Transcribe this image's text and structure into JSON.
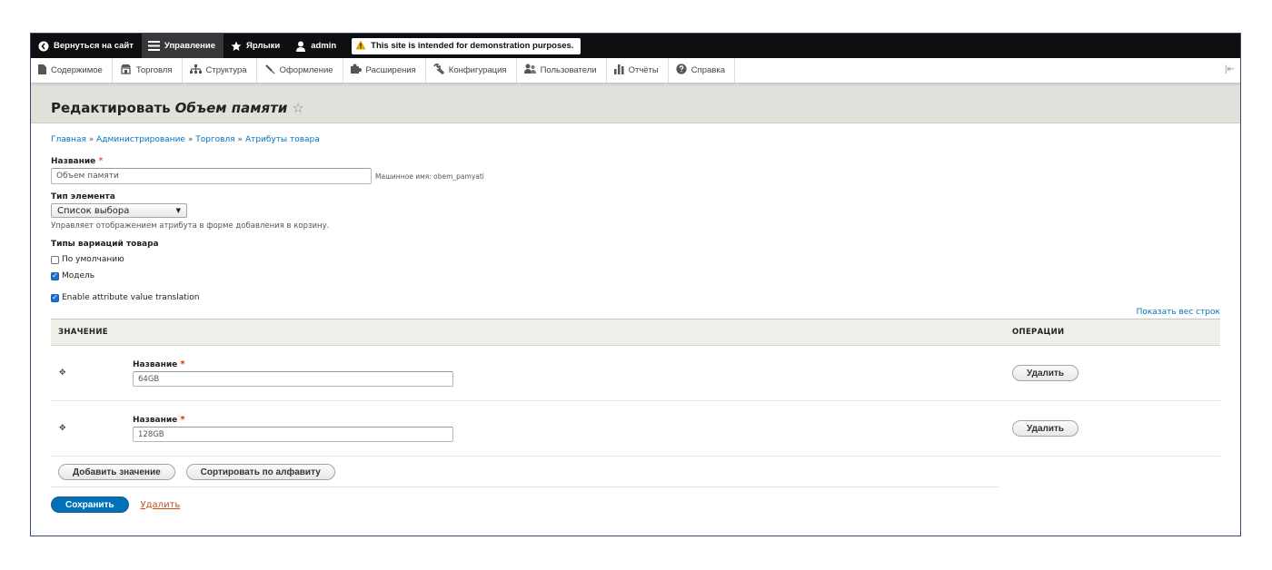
{
  "toolbar": {
    "back_label": "Вернуться на сайт",
    "manage_label": "Управление",
    "shortcuts_label": "Ярлыки",
    "user_label": "admin",
    "demo_message": "This site is intended for demonstration purposes."
  },
  "tray": {
    "items": [
      "Содержимое",
      "Торговля",
      "Структура",
      "Оформление",
      "Расширения",
      "Конфигурация",
      "Пользователи",
      "Отчёты",
      "Справка"
    ]
  },
  "page": {
    "title_prefix": "Редактировать",
    "title_name": "Объем памяти"
  },
  "breadcrumb": {
    "items": [
      "Главная",
      "Администрирование",
      "Торговля",
      "Атрибуты товара"
    ],
    "separator": "»"
  },
  "form": {
    "name_label": "Название",
    "name_value": "Объем памяти",
    "machine_name": "Машинное имя: obem_pamyati",
    "type_label": "Тип элемента",
    "type_value": "Список выбора",
    "type_description": "Управляет отображением атрибута в форме добавления в корзину.",
    "variation_types_label": "Типы вариаций товара",
    "checkboxes": [
      {
        "label": "По умолчанию",
        "checked": false
      },
      {
        "label": "Модель",
        "checked": true
      }
    ],
    "translation": {
      "label": "Enable attribute value translation",
      "checked": true
    }
  },
  "values_table": {
    "show_weights_link": "Показать вес строк",
    "headers": [
      "ЗНАЧЕНИЕ",
      "ОПЕРАЦИИ"
    ],
    "rows": [
      {
        "label": "Название",
        "value": "64GB",
        "delete_label": "Удалить"
      },
      {
        "label": "Название",
        "value": "128GB",
        "delete_label": "Удалить"
      }
    ],
    "add_value_label": "Добавить значение",
    "sort_label": "Сортировать по алфавиту"
  },
  "footer_actions": {
    "save_label": "Сохранить",
    "delete_label": "Удалить"
  },
  "colors": {
    "toolbar_bg": "#0f0f0f",
    "link": "#0074bd",
    "primary": "#0071b8",
    "required": "#e32700",
    "header_bg": "#e1e0db"
  }
}
